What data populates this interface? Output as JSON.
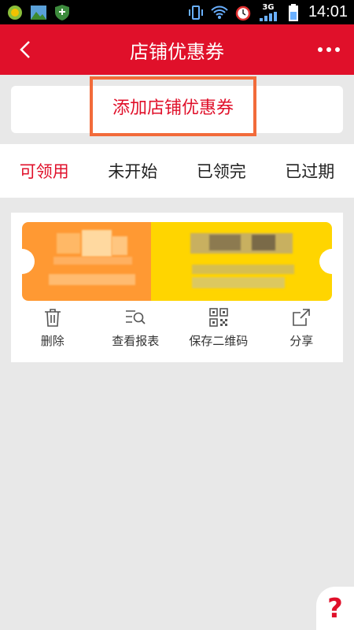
{
  "status_bar": {
    "time": "14:01",
    "network": "3G",
    "left_icons": [
      "app-icon",
      "image-icon",
      "shield-icon"
    ],
    "right_icons": [
      "vibrate-icon",
      "wifi-icon",
      "alarm-icon",
      "signal-icon",
      "battery-icon"
    ]
  },
  "header": {
    "title": "店铺优惠券",
    "back_icon": "chevron-left-icon",
    "more_icon": "more-dots-icon"
  },
  "add_coupon": {
    "label": "添加店铺优惠券"
  },
  "tabs": [
    {
      "label": "可领用",
      "active": true
    },
    {
      "label": "未开始",
      "active": false
    },
    {
      "label": "已领完",
      "active": false
    },
    {
      "label": "已过期",
      "active": false
    }
  ],
  "coupon": {
    "left_color": "#ff9933",
    "right_color": "#ffd500"
  },
  "coupon_actions": [
    {
      "label": "删除",
      "icon": "trash-icon"
    },
    {
      "label": "查看报表",
      "icon": "report-search-icon"
    },
    {
      "label": "保存二维码",
      "icon": "qr-code-icon"
    },
    {
      "label": "分享",
      "icon": "share-icon"
    }
  ],
  "help": {
    "label": "?"
  },
  "colors": {
    "brand_red": "#e0102a",
    "highlight_orange": "#f26b3a",
    "background": "#e8e8e8"
  }
}
